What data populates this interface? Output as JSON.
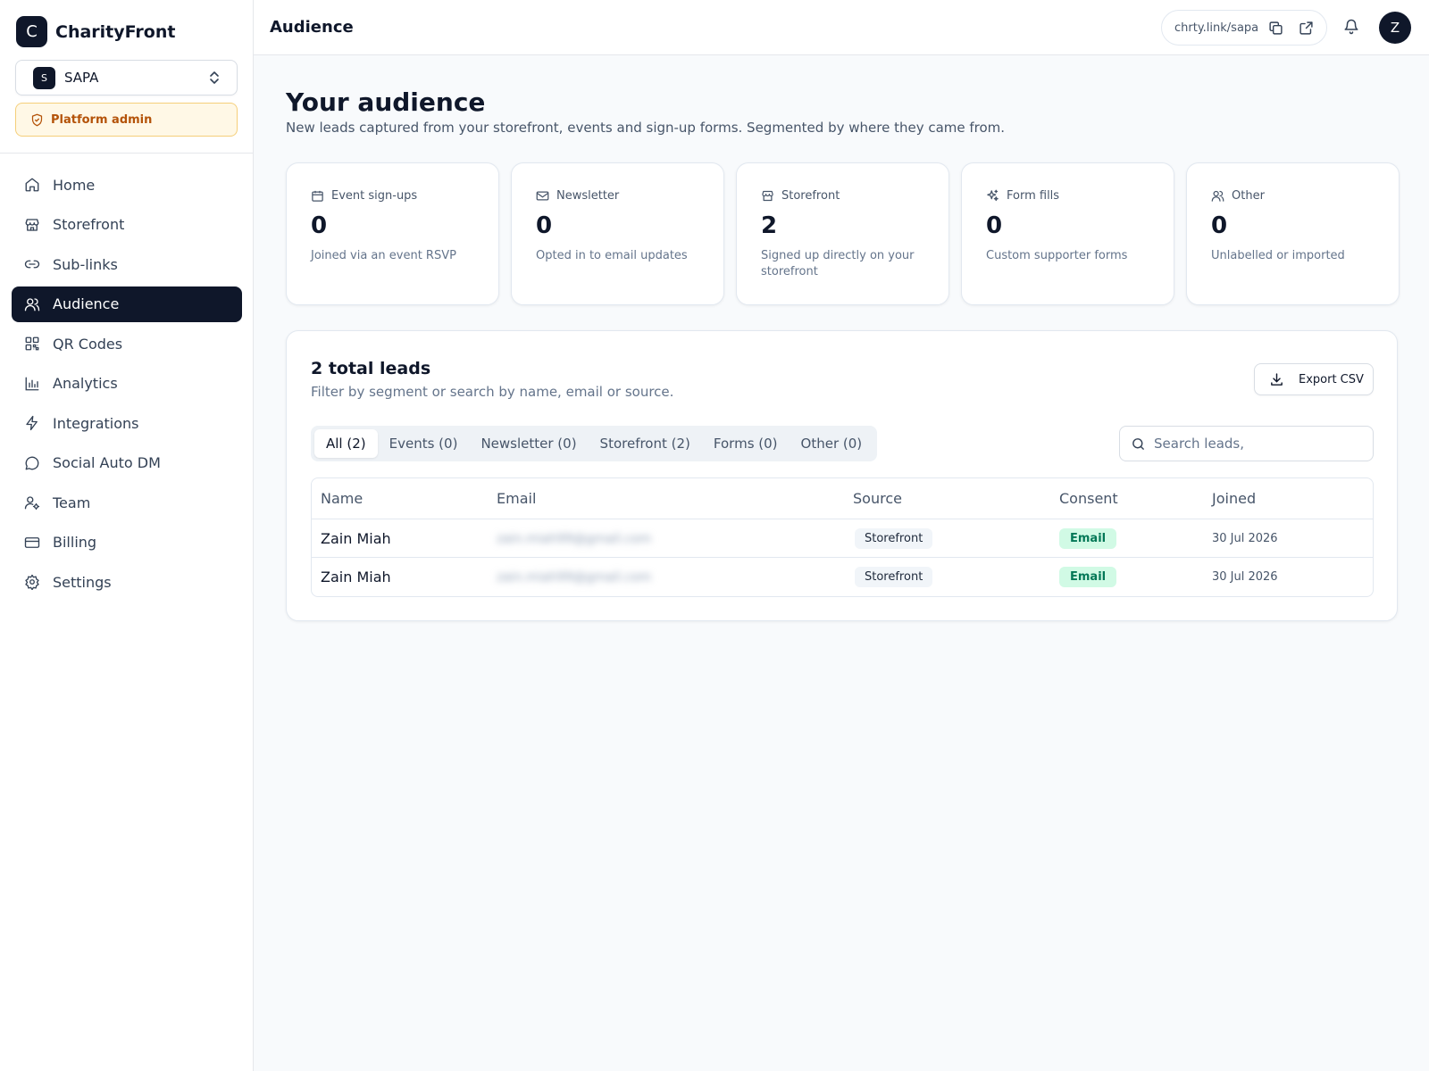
{
  "sidebar": {
    "brand_initial": "C",
    "brand_name": "CharityFront",
    "org": {
      "initial": "S",
      "name": "SAPA"
    },
    "admin_label": "Platform admin",
    "items": [
      {
        "label": "Home",
        "icon": "home-icon"
      },
      {
        "label": "Storefront",
        "icon": "store-icon"
      },
      {
        "label": "Sub-links",
        "icon": "link-icon"
      },
      {
        "label": "Audience",
        "icon": "users-icon",
        "active": true
      },
      {
        "label": "QR Codes",
        "icon": "qr-code-icon"
      },
      {
        "label": "Analytics",
        "icon": "bar-chart-icon"
      },
      {
        "label": "Integrations",
        "icon": "zap-icon"
      },
      {
        "label": "Social Auto DM",
        "icon": "message-circle-icon"
      },
      {
        "label": "Team",
        "icon": "user-cog-icon"
      },
      {
        "label": "Billing",
        "icon": "credit-card-icon"
      },
      {
        "label": "Settings",
        "icon": "gear-icon"
      }
    ]
  },
  "header": {
    "title": "Audience",
    "link": "chrty.link/sapa",
    "avatar_initial": "Z"
  },
  "main": {
    "title": "Your audience",
    "subtitle": "New leads captured from your storefront, events and sign-up forms. Segmented by where they came from.",
    "stats": [
      {
        "label": "Event sign-ups",
        "value": "0",
        "desc": "Joined via an event RSVP",
        "icon": "calendar-icon"
      },
      {
        "label": "Newsletter",
        "value": "0",
        "desc": "Opted in to email updates",
        "icon": "mail-icon"
      },
      {
        "label": "Storefront",
        "value": "2",
        "desc": "Signed up directly on your storefront",
        "icon": "store-icon"
      },
      {
        "label": "Form fills",
        "value": "0",
        "desc": "Custom supporter forms",
        "icon": "sparkles-icon"
      },
      {
        "label": "Other",
        "value": "0",
        "desc": "Unlabelled or imported",
        "icon": "users-icon"
      }
    ],
    "leads": {
      "title": "2 total leads",
      "subtitle": "Filter by segment or search by name, email or source.",
      "export_label": "Export CSV",
      "tabs": [
        "All (2)",
        "Events (0)",
        "Newsletter (0)",
        "Storefront (2)",
        "Forms (0)",
        "Other (0)"
      ],
      "active_tab": 0,
      "search_placeholder": "Search leads,",
      "columns": [
        "Name",
        "Email",
        "Source",
        "Consent",
        "Joined"
      ],
      "rows": [
        {
          "name": "Zain Miah",
          "email": "zain.miah99@gmail.com",
          "source": "Storefront",
          "consent": "Email",
          "joined": "30 Jul 2026"
        },
        {
          "name": "Zain Miah",
          "email": "zain.miah99@gmail.com",
          "source": "Storefront",
          "consent": "Email",
          "joined": "30 Jul 2026"
        }
      ]
    }
  },
  "colors": {
    "primary": "#0f172a",
    "admin_text": "#b45309",
    "admin_bg": "#fff8e6",
    "consent_bg": "#d1fae5",
    "consent_text": "#047857"
  }
}
